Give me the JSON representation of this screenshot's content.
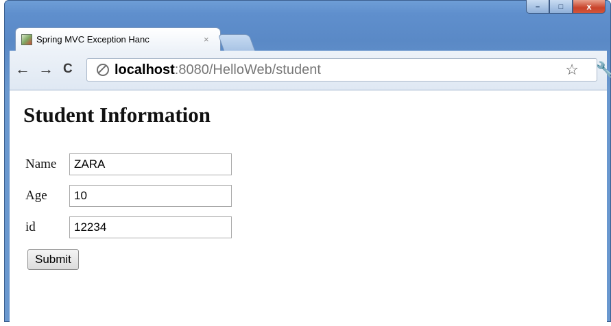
{
  "browser": {
    "tab_title": "Spring MVC Exception Hanc",
    "tab_close": "×",
    "url_host": "localhost",
    "url_rest": ":8080/HelloWeb/student",
    "window_min": "–",
    "window_max": "□",
    "window_close": "x"
  },
  "page": {
    "title": "Student Information",
    "fields": [
      {
        "label": "Name",
        "value": "ZARA"
      },
      {
        "label": "Age",
        "value": "10"
      },
      {
        "label": "id",
        "value": "12234"
      }
    ],
    "submit_label": "Submit"
  }
}
